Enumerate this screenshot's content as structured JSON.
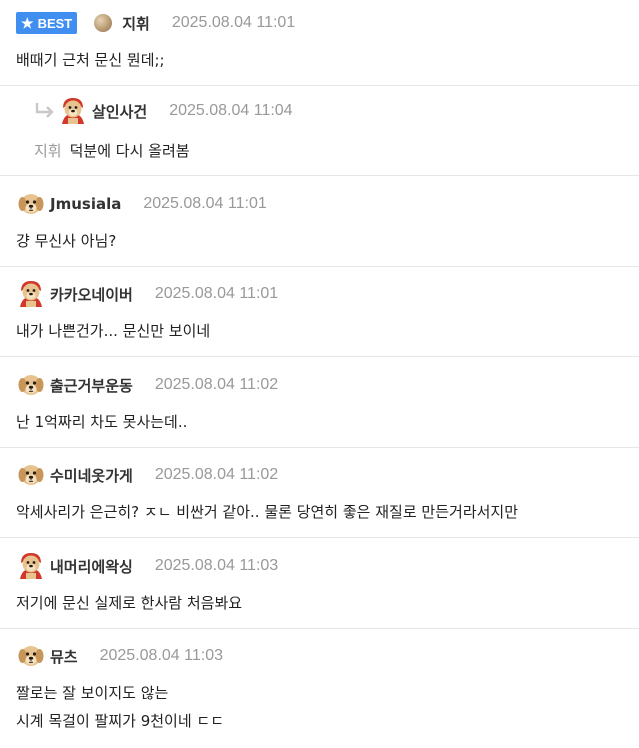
{
  "comments": [
    {
      "best_label": "BEST",
      "nickname": "지휘",
      "time": "2025.08.04 11:01",
      "text": "배때기 근처 문신 뭔데;;"
    },
    {
      "nickname": "살인사건",
      "time": "2025.08.04 11:04",
      "mention": "지휘",
      "text": "덕분에 다시 올려봄"
    },
    {
      "nickname": "Jmusiala",
      "time": "2025.08.04 11:01",
      "text": "걍 무신사 아님?"
    },
    {
      "nickname": "카카오네이버",
      "time": "2025.08.04 11:01",
      "text": "내가 나쁜건가... 문신만 보이네"
    },
    {
      "nickname": "출근거부운동",
      "time": "2025.08.04 11:02",
      "text": "난 1억짜리 차도 못사는데.."
    },
    {
      "nickname": "수미네옷가게",
      "time": "2025.08.04 11:02",
      "text": "악세사리가 은근히? ㅈㄴ 비싼거 같아.. 물론 당연히 좋은 재질로 만든거라서지만"
    },
    {
      "nickname": "내머리에왁싱",
      "time": "2025.08.04 11:03",
      "text": "저기에 문신 실제로 한사람 처음봐요"
    },
    {
      "nickname": "뮤츠",
      "time": "2025.08.04 11:03",
      "text_lines": [
        "짤로는 잘 보이지도 않는",
        "시계 목걸이 팔찌가 9천이네 ㄷㄷ"
      ]
    }
  ],
  "icons": {
    "best": "star-icon",
    "level": "level-ball-icon",
    "reply": "reply-arrow-icon",
    "avatar_dog": "dog-avatar-icon",
    "avatar_dog_cape": "dog-cape-avatar-icon"
  },
  "colors": {
    "best_badge": "#3f8ef0",
    "time": "#999999",
    "divider": "#e6e6e6"
  }
}
